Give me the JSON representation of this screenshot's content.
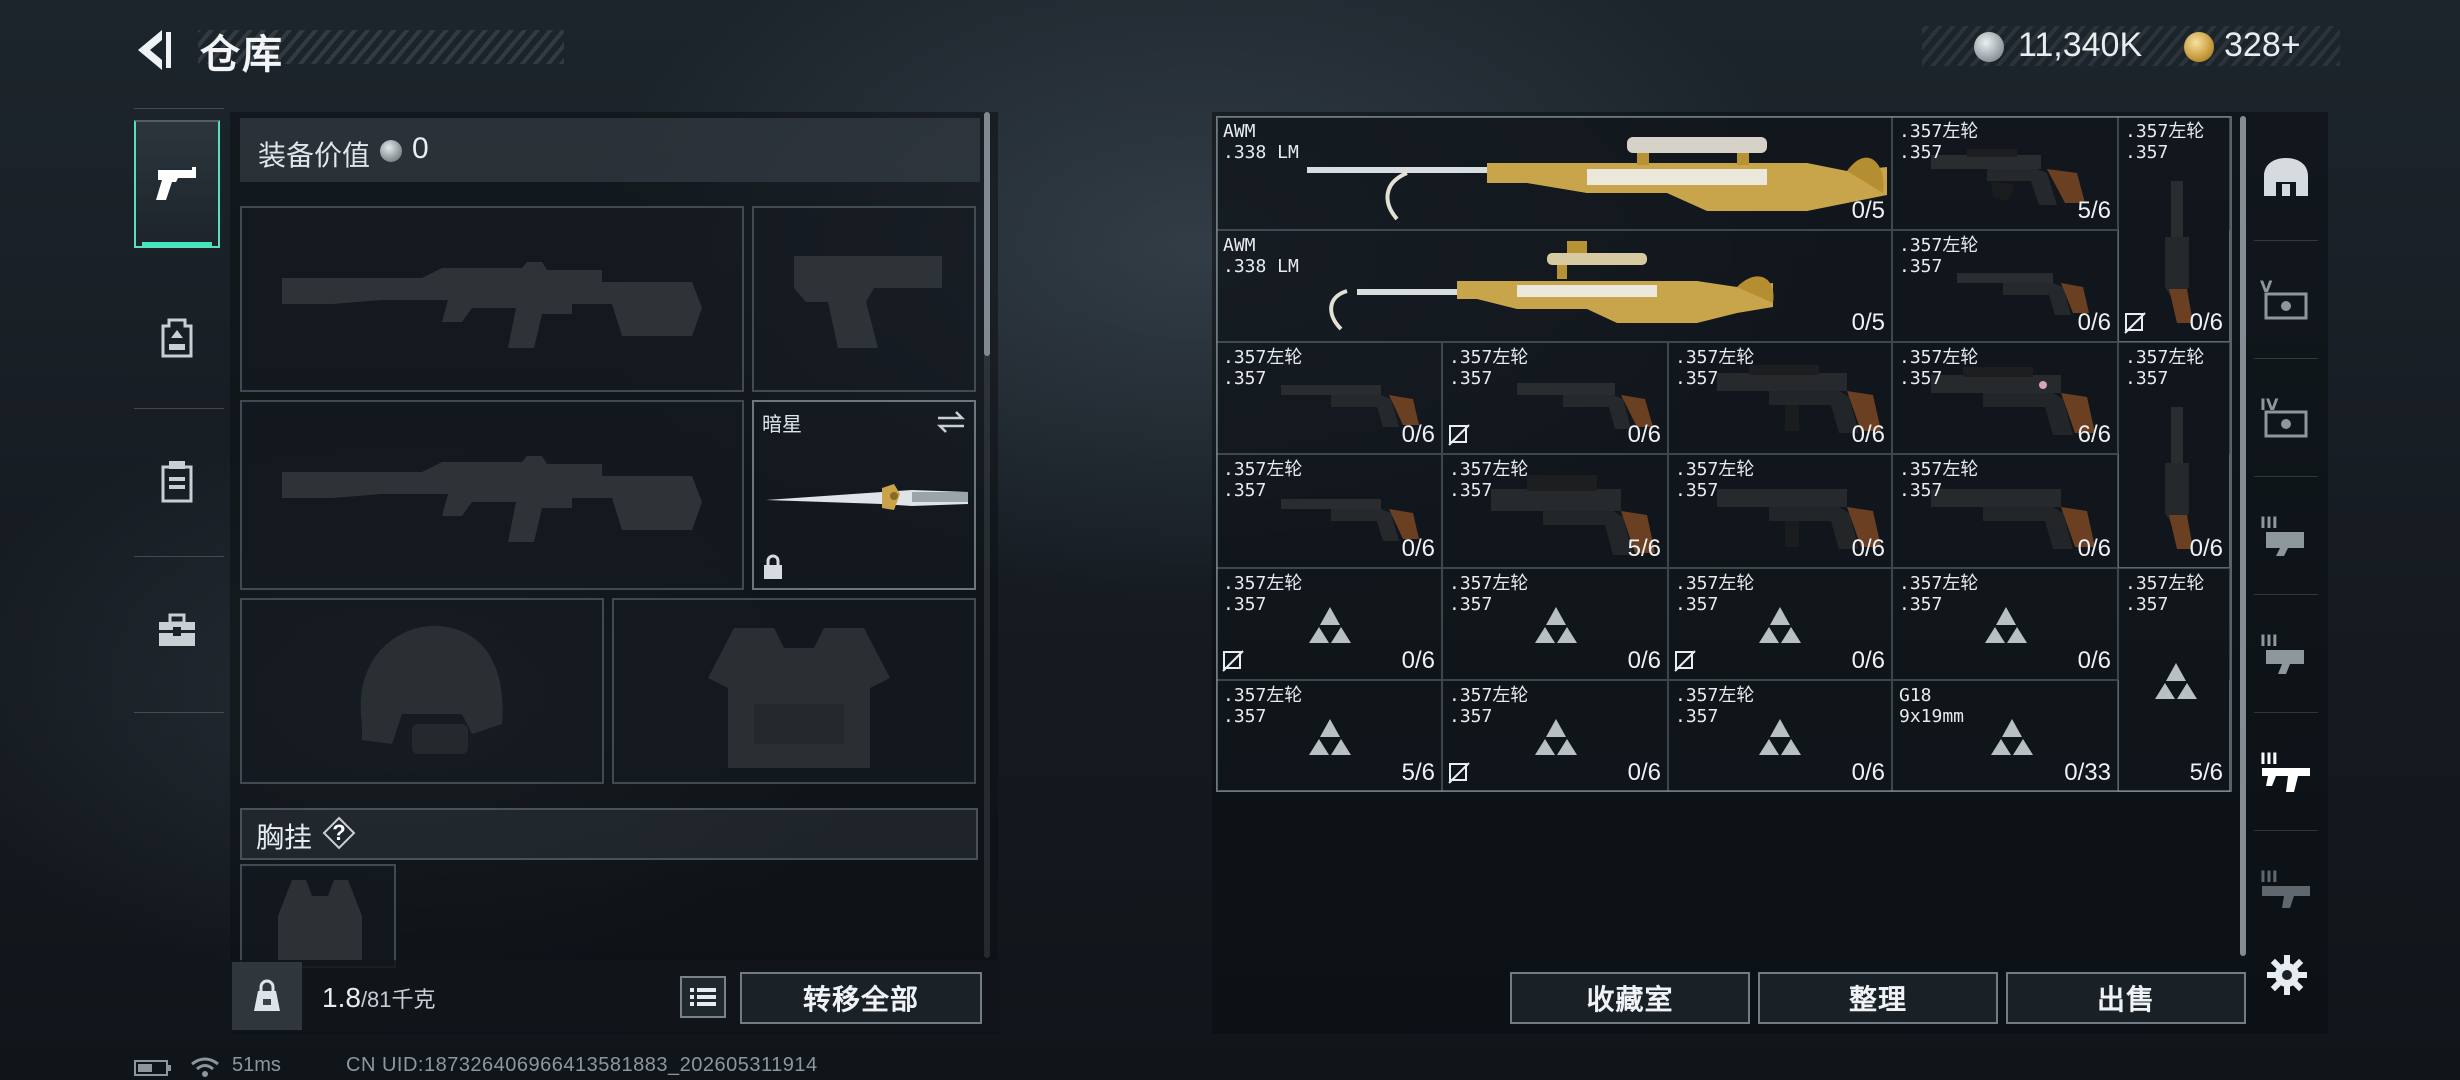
{
  "header": {
    "title": "仓库",
    "back_icon": "chevron-left-icon",
    "currencies": [
      {
        "name": "silver-coin",
        "value": "11,340K",
        "color": "#b8c0c4"
      },
      {
        "name": "gold-coin",
        "value": "328+",
        "color": "#c89a3c"
      }
    ]
  },
  "left_tabs": [
    {
      "icon": "pistol-icon",
      "active": true
    },
    {
      "icon": "backpack-icon",
      "active": false
    },
    {
      "icon": "vest-icon",
      "active": false
    },
    {
      "icon": "toolbox-icon",
      "active": false
    }
  ],
  "loadout": {
    "equip_value_label": "装备价值",
    "equip_value": "0",
    "melee_slot_name": "暗星",
    "chest_rig_label": "胸挂",
    "chest_help": "?",
    "weight_value": "1.8",
    "weight_max": "/81千克",
    "transfer_all": "转移全部"
  },
  "grid_items": [
    {
      "name": "AWM\n.338 LM",
      "count": "0/5"
    },
    {
      "name": ".357左轮\n.357",
      "count": "5/6"
    },
    {
      "name": ".357左轮\n.357",
      "count": ""
    },
    {
      "name": "AWM\n.338 LM",
      "count": "0/5"
    },
    {
      "name": ".357左轮\n.357",
      "count": "0/6"
    },
    {
      "name": "",
      "count": "0/6"
    },
    {
      "name": ".357左轮\n.357",
      "count": "0/6"
    },
    {
      "name": ".357左轮\n.357",
      "count": "0/6"
    },
    {
      "name": ".357左轮\n.357",
      "count": "0/6"
    },
    {
      "name": ".357左轮\n.357",
      "count": "6/6"
    },
    {
      "name": ".357左轮\n.357",
      "count": ""
    },
    {
      "name": ".357左轮\n.357",
      "count": "0/6"
    },
    {
      "name": ".357左轮\n.357",
      "count": "5/6"
    },
    {
      "name": ".357左轮\n.357",
      "count": "0/6"
    },
    {
      "name": ".357左轮\n.357",
      "count": "0/6"
    },
    {
      "name": "",
      "count": "0/6"
    },
    {
      "name": ".357左轮\n.357",
      "count": "0/6"
    },
    {
      "name": ".357左轮\n.357",
      "count": "0/6"
    },
    {
      "name": ".357左轮\n.357",
      "count": "0/6"
    },
    {
      "name": ".357左轮\n.357",
      "count": "0/6"
    },
    {
      "name": ".357左轮\n.357",
      "count": ""
    },
    {
      "name": ".357左轮\n.357",
      "count": "5/6"
    },
    {
      "name": ".357左轮\n.357",
      "count": "0/6"
    },
    {
      "name": ".357左轮\n.357",
      "count": "0/6"
    },
    {
      "name": "G18\n9x19mm",
      "count": "0/33"
    },
    {
      "name": "",
      "count": "5/6"
    }
  ],
  "right_tabs": [
    {
      "icon": "helmet-icon"
    },
    {
      "icon": "tier-v-case-icon",
      "tier": "V"
    },
    {
      "icon": "tier-iv-case-icon",
      "tier": "IV"
    },
    {
      "icon": "tier-iii-case-icon",
      "tier": "III"
    },
    {
      "icon": "tier-iii-box-icon",
      "tier": "III"
    },
    {
      "icon": "tier-iii-rifle-icon",
      "tier": "III",
      "active": true
    },
    {
      "icon": "tier-iii-gun-icon",
      "tier": "III"
    }
  ],
  "bottom_buttons": {
    "collection": "收藏室",
    "sort": "整理",
    "sell": "出售"
  },
  "status": {
    "ping": "51ms",
    "uid": "CN UID:18732640696641358188​3_202605311914"
  }
}
